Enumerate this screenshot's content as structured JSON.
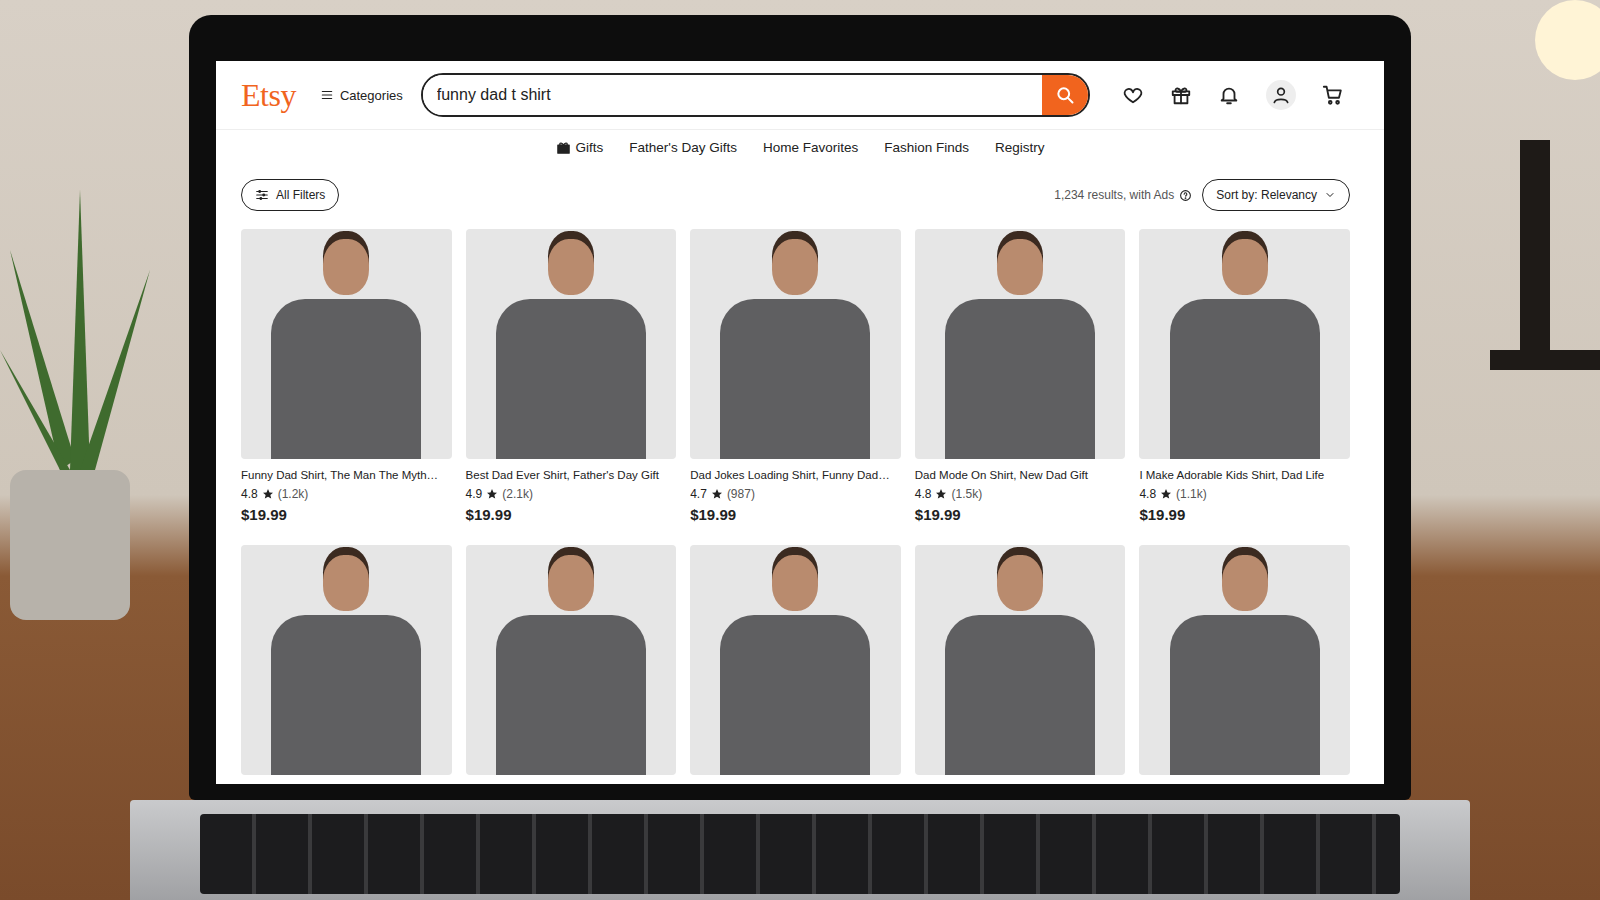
{
  "header": {
    "logo": "Etsy",
    "categories": "Categories",
    "search": {
      "value": "funny dad t shirt"
    }
  },
  "nav": [
    "Gifts",
    "Father's Day Gifts",
    "Home Favorites",
    "Fashion Finds",
    "Registry"
  ],
  "toolbar": {
    "filters": "All Filters",
    "results": "1,234 results, with Ads",
    "sort": "Sort by: Relevancy"
  },
  "listings": [
    {
      "title": "Funny Dad Shirt, The Man The Myth…",
      "rating": "4.8",
      "count": "(1.2k)",
      "price": "$19.99"
    },
    {
      "title": "Best Dad Ever Shirt, Father's Day Gift",
      "rating": "4.9",
      "count": "(2.1k)",
      "price": "$19.99"
    },
    {
      "title": "Dad Jokes Loading Shirt, Funny Dad…",
      "rating": "4.7",
      "count": "(987)",
      "price": "$19.99"
    },
    {
      "title": "Dad Mode On Shirt, New Dad Gift",
      "rating": "4.8",
      "count": "(1.5k)",
      "price": "$19.99"
    },
    {
      "title": "I Make Adorable Kids Shirt, Dad Life",
      "rating": "4.8",
      "count": "(1.1k)",
      "price": "$19.99"
    }
  ]
}
